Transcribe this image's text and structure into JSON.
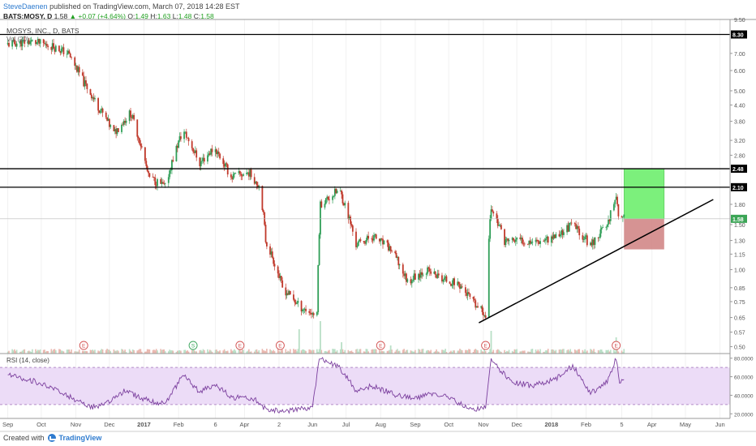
{
  "header": {
    "author": "SteveDaenen",
    "published": "published on TradingView.com, March 07, 2018 14:28 EST",
    "symbol": "BATS:MOSY, D",
    "close": "1.58",
    "change": "+0.07 (+4.64%)",
    "o_label": "O:",
    "o": "1.49",
    "h_label": "H:",
    "h": "1.63",
    "l_label": "L:",
    "l": "1.48",
    "c_label": "C:",
    "c": "1.58"
  },
  "footer": {
    "created_with": "Created with",
    "brand": "TradingView"
  },
  "colors": {
    "up": "#2f9e57",
    "down": "#c0392b",
    "volume_up": "#b9dfc6",
    "volume_down": "#eab8b0",
    "rsi_band": "#ecdcf7",
    "rsi_line": "#7b3f9e",
    "target_box": "#7cf07c",
    "stop_box": "#cf8080",
    "accent": "#2e7bcf"
  },
  "chart_data": [
    {
      "type": "candlestick",
      "title": "MOSYS, INC., D, BATS",
      "indicator_label": "Vol (20)",
      "scale": "log",
      "ylim": [
        0.47,
        9.5
      ],
      "x_tick_labels": [
        "Sep",
        "Oct",
        "Nov",
        "Dec",
        "2017",
        "Feb",
        "6",
        "Apr",
        "2",
        "Jun",
        "Jul",
        "Aug",
        "Sep",
        "Oct",
        "Nov",
        "Dec",
        "2018",
        "Feb",
        "5",
        "Apr",
        "May",
        "Jun"
      ],
      "y_tick_labels": [
        "9.50",
        "8.30",
        "7.00",
        "6.00",
        "5.00",
        "4.40",
        "3.80",
        "3.20",
        "2.80",
        "2.48",
        "2.10",
        "1.80",
        "1.58",
        "1.50",
        "1.30",
        "1.15",
        "1.00",
        "0.85",
        "0.75",
        "0.65",
        "0.57",
        "0.50"
      ],
      "horizontal_levels": [
        8.3,
        2.48,
        2.1
      ],
      "price_tag": 1.58,
      "trendline": {
        "start": [
          "Oct 28 2017",
          0.62
        ],
        "end": [
          "May 26 2018",
          1.88
        ]
      },
      "target_box": {
        "from": [
          "Mar 07 2018",
          1.58
        ],
        "to": [
          "Apr 12 2018",
          2.48
        ]
      },
      "stop_box": {
        "from": [
          "Mar 07 2018",
          1.2
        ],
        "to": [
          "Apr 12 2018",
          1.58
        ]
      },
      "events": [
        {
          "label": "E",
          "date": "Nov 08 2016"
        },
        {
          "label": "S",
          "date": "Feb 14 2017"
        },
        {
          "label": "E",
          "date": "Mar 28 2017"
        },
        {
          "label": "E",
          "date": "May 03 2017"
        },
        {
          "label": "E",
          "date": "Aug 01 2017"
        },
        {
          "label": "E",
          "date": "Nov 03 2017"
        },
        {
          "label": "E",
          "date": "Feb 28 2018"
        }
      ],
      "price_points": [
        [
          "Sep 01 2016",
          7.6
        ],
        [
          "Sep 20 2016",
          7.8
        ],
        [
          "Oct 10 2016",
          7.5
        ],
        [
          "Oct 25 2016",
          7.0
        ],
        [
          "Nov 08 2016",
          5.4
        ],
        [
          "Nov 20 2016",
          4.4
        ],
        [
          "Dec 05 2016",
          3.4
        ],
        [
          "Dec 20 2016",
          4.1
        ],
        [
          "Jan 05 2017",
          2.3
        ],
        [
          "Jan 20 2017",
          2.1
        ],
        [
          "Feb 05 2017",
          3.5
        ],
        [
          "Feb 20 2017",
          2.6
        ],
        [
          "Mar 05 2017",
          3.0
        ],
        [
          "Mar 20 2017",
          2.3
        ],
        [
          "Apr 05 2017",
          2.4
        ],
        [
          "Apr 15 2017",
          2.1
        ],
        [
          "Apr 20 2017",
          1.3
        ],
        [
          "May 05 2017",
          0.85
        ],
        [
          "May 20 2017",
          0.72
        ],
        [
          "Jun 05 2017",
          0.66
        ],
        [
          "Jun 08 2017",
          1.8
        ],
        [
          "Jun 25 2017",
          2.05
        ],
        [
          "Jul 10 2017",
          1.25
        ],
        [
          "Jul 25 2017",
          1.35
        ],
        [
          "Aug 10 2017",
          1.2
        ],
        [
          "Aug 25 2017",
          0.9
        ],
        [
          "Sep 10 2017",
          1.0
        ],
        [
          "Sep 25 2017",
          0.92
        ],
        [
          "Oct 10 2017",
          0.88
        ],
        [
          "Oct 25 2017",
          0.72
        ],
        [
          "Nov 03 2017",
          0.67
        ],
        [
          "Nov 08 2017",
          1.75
        ],
        [
          "Nov 20 2017",
          1.3
        ],
        [
          "Dec 05 2017",
          1.3
        ],
        [
          "Dec 20 2017",
          1.3
        ],
        [
          "Jan 05 2018",
          1.35
        ],
        [
          "Jan 20 2018",
          1.5
        ],
        [
          "Feb 05 2018",
          1.25
        ],
        [
          "Feb 20 2018",
          1.5
        ],
        [
          "Feb 28 2018",
          1.95
        ],
        [
          "Mar 03 2018",
          1.52
        ],
        [
          "Mar 07 2018",
          1.58
        ]
      ]
    },
    {
      "type": "line",
      "title": "RSI (14, close)",
      "ylim": [
        15,
        85
      ],
      "y_tick_labels": [
        "80.0000",
        "60.0000",
        "40.0000",
        "20.0000"
      ],
      "band": [
        30,
        70
      ],
      "points": [
        [
          "Sep 01 2016",
          62
        ],
        [
          "Sep 25 2016",
          55
        ],
        [
          "Oct 15 2016",
          45
        ],
        [
          "Nov 01 2016",
          35
        ],
        [
          "Nov 15 2016",
          27
        ],
        [
          "Dec 01 2016",
          32
        ],
        [
          "Dec 15 2016",
          45
        ],
        [
          "Jan 01 2017",
          36
        ],
        [
          "Jan 20 2017",
          30
        ],
        [
          "Feb 05 2017",
          62
        ],
        [
          "Feb 20 2017",
          43
        ],
        [
          "Mar 05 2017",
          52
        ],
        [
          "Mar 20 2017",
          38
        ],
        [
          "Apr 10 2017",
          36
        ],
        [
          "Apr 20 2017",
          25
        ],
        [
          "May 10 2017",
          23
        ],
        [
          "Jun 01 2017",
          27
        ],
        [
          "Jun 07 2017",
          80
        ],
        [
          "Jun 25 2017",
          70
        ],
        [
          "Jul 10 2017",
          45
        ],
        [
          "Jul 25 2017",
          50
        ],
        [
          "Aug 15 2017",
          40
        ],
        [
          "Sep 01 2017",
          36
        ],
        [
          "Sep 15 2017",
          42
        ],
        [
          "Oct 01 2017",
          38
        ],
        [
          "Oct 20 2017",
          24
        ],
        [
          "Nov 03 2017",
          28
        ],
        [
          "Nov 08 2017",
          78
        ],
        [
          "Nov 25 2017",
          55
        ],
        [
          "Dec 15 2017",
          50
        ],
        [
          "Jan 05 2018",
          58
        ],
        [
          "Jan 20 2018",
          72
        ],
        [
          "Feb 05 2018",
          42
        ],
        [
          "Feb 20 2018",
          55
        ],
        [
          "Feb 28 2018",
          80
        ],
        [
          "Mar 03 2018",
          52
        ],
        [
          "Mar 07 2018",
          57
        ]
      ]
    }
  ]
}
